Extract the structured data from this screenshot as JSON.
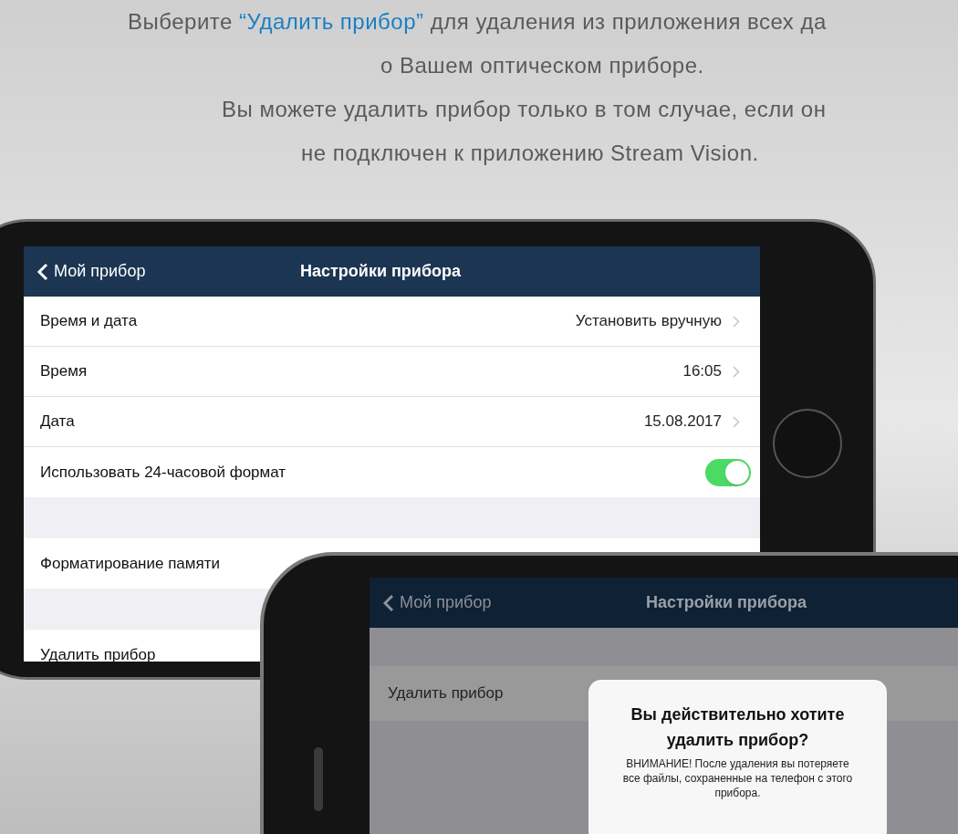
{
  "caption": {
    "lines": [
      [
        {
          "text": "Выберите ",
          "highlight": false
        },
        {
          "text": "“Удалить прибор”",
          "highlight": true
        },
        {
          "text": " для удаления из приложения всех да",
          "highlight": false
        }
      ],
      [
        {
          "text": "о Вашем оптическом приборе.",
          "highlight": false
        }
      ],
      [
        {
          "text": "Вы можете удалить прибор только в том случае, если он",
          "highlight": false
        }
      ],
      [
        {
          "text": "не подключен к приложению Stream Vision.",
          "highlight": false
        }
      ]
    ]
  },
  "phone_back": {
    "nav": {
      "back": "Мой прибор",
      "title": "Настройки прибора"
    },
    "sections": [
      [
        {
          "kind": "value",
          "label": "Время и дата",
          "value": "Установить вручную"
        },
        {
          "kind": "value",
          "label": "Время",
          "value": "16:05"
        },
        {
          "kind": "value",
          "label": "Дата",
          "value": "15.08.2017"
        },
        {
          "kind": "toggle",
          "label": "Использовать 24-часовой формат",
          "on": true
        }
      ],
      [
        {
          "kind": "plain",
          "label": "Форматирование памяти"
        }
      ],
      [
        {
          "kind": "plain",
          "label": "Удалить прибор"
        }
      ]
    ]
  },
  "phone_front": {
    "nav": {
      "back": "Мой прибор",
      "title": "Настройки прибора"
    },
    "rows": [
      {
        "label": "Удалить прибор"
      }
    ],
    "dialog": {
      "title": "Вы действительно хотите удалить прибор?",
      "message": "ВНИМАНИЕ! После удаления вы потеряете все файлы, сохраненные на телефон с этого прибора."
    }
  }
}
